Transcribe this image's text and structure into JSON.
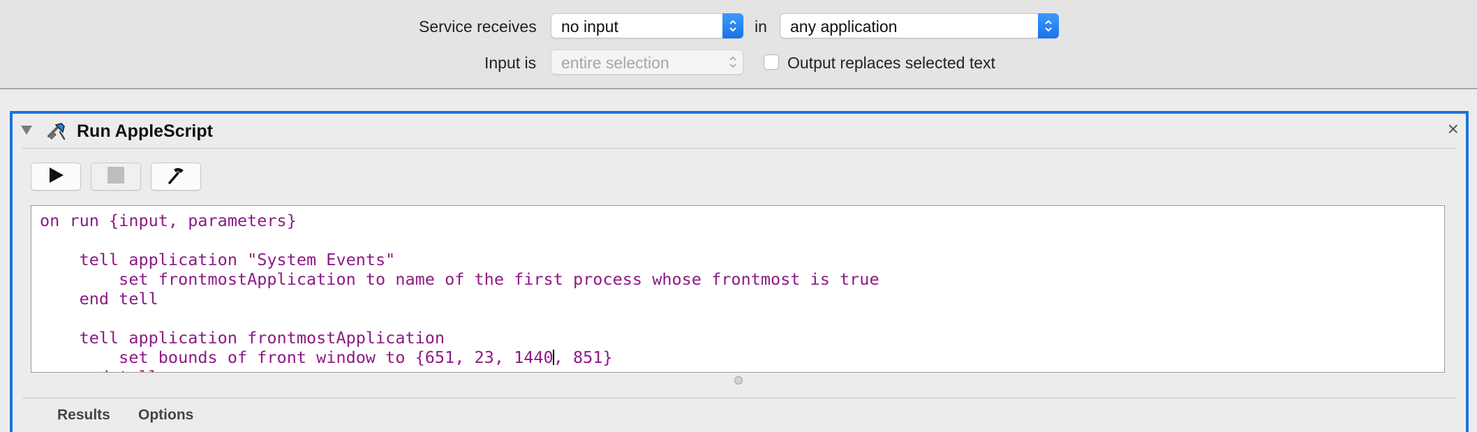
{
  "service": {
    "receives_label": "Service receives",
    "receives_value": "no input",
    "in_label": "in",
    "application_value": "any application",
    "input_is_label": "Input is",
    "input_is_value": "entire selection",
    "output_replaces_label": "Output replaces selected text",
    "output_replaces_checked": false
  },
  "action": {
    "title": "Run AppleScript",
    "close_glyph": "×",
    "toolbar": [
      "play-icon",
      "stop-icon",
      "hammer-icon"
    ],
    "code_lines": [
      "on run {input, parameters}",
      "",
      "    tell application \"System Events\"",
      "        set frontmostApplication to name of the first process whose frontmost is true",
      "    end tell",
      "",
      "    tell application frontmostApplication",
      "        set bounds of front window to {651, 23, 1440, 851}",
      "    end tell"
    ],
    "caret_after": "set bounds of front window to {651, 23, 1440",
    "tabs": [
      "Results",
      "Options"
    ]
  },
  "colors": {
    "accent": "#1a74dc",
    "code_text": "#8e1a86",
    "popup_stepper": "#1873e8"
  }
}
